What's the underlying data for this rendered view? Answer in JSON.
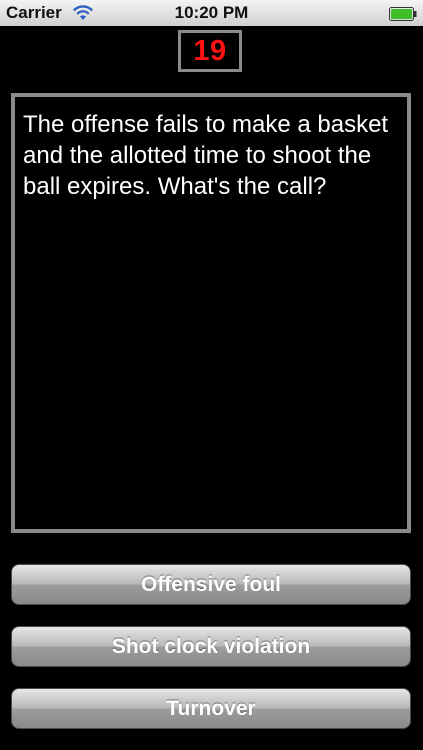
{
  "status_bar": {
    "carrier": "Carrier",
    "time": "10:20 PM",
    "wifi_icon": "wifi-icon",
    "battery_icon": "battery-full-icon",
    "battery_color": "#3fbf2a"
  },
  "shot_clock": {
    "value": "19",
    "color": "#ff1212"
  },
  "question": {
    "text": "The offense fails to make a basket and the allotted time to shoot the ball expires.  What's the call?"
  },
  "answers": [
    {
      "label": "Offensive foul"
    },
    {
      "label": "Shot clock violation"
    },
    {
      "label": "Turnover"
    }
  ]
}
